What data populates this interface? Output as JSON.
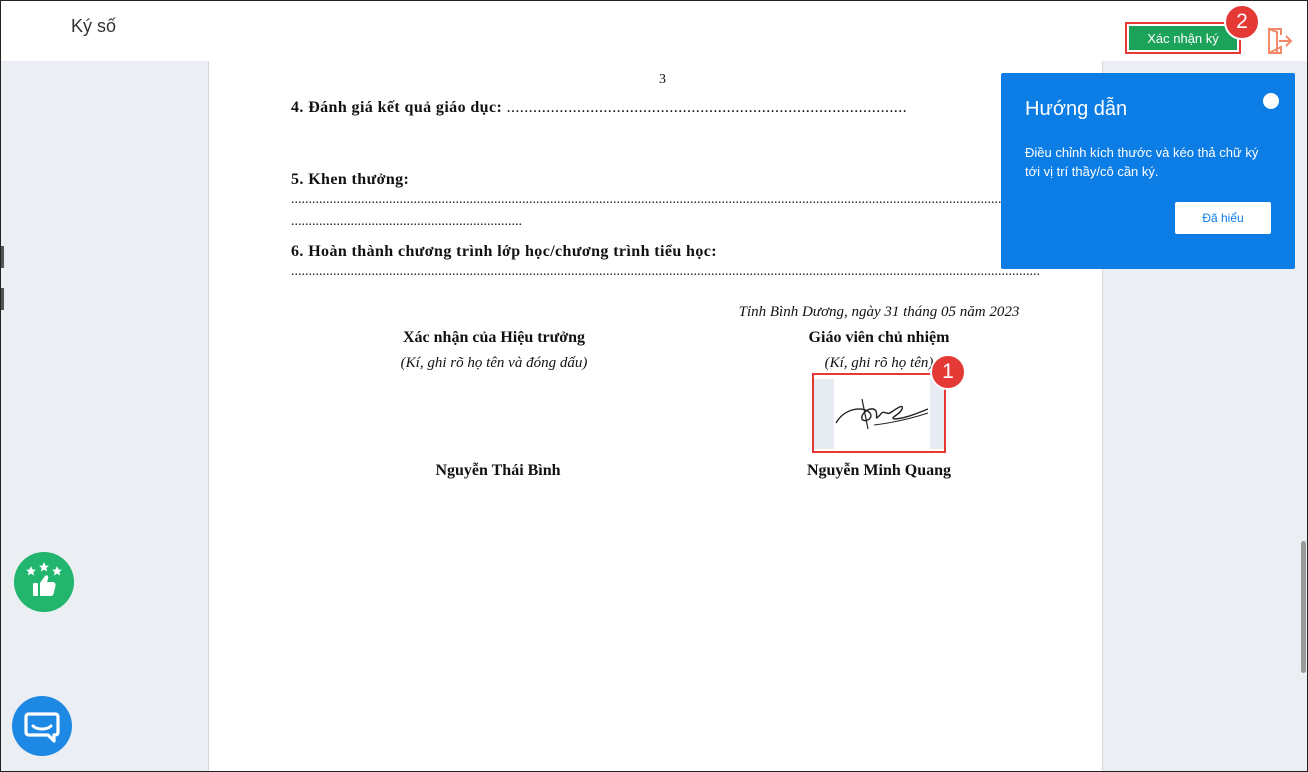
{
  "header": {
    "title": "Ký số",
    "confirm_label": "Xác nhận ký",
    "step_badge": "2",
    "exit_icon": "exit-door-icon"
  },
  "document": {
    "page_number": "3",
    "section4": {
      "heading": "4. Đánh giá kết quả giáo dục:",
      "dots": " ..........................................................................................."
    },
    "section5": {
      "heading": "5. Khen thưởng:",
      "line1": "......................................................................................................................................................................................................................",
      "line2": ".................................................................."
    },
    "section6": {
      "heading": "6. Hoàn thành chương trình lớp học/chương trình tiểu học:",
      "line1": "......................................................................................................................................................................................................................"
    },
    "place_date": "Tỉnh Bình Dương, ngày 31 tháng 05 năm 2023",
    "left_sign": {
      "title": "Xác nhận của Hiệu trưởng",
      "note": "(Kí, ghi rõ họ tên và đóng dấu)",
      "name": "Nguyễn Thái Bình"
    },
    "right_sign": {
      "title": "Giáo viên chủ nhiệm",
      "note": "(Kí, ghi rõ họ tên)",
      "name": "Nguyễn Minh Quang"
    },
    "step_badge": "1"
  },
  "guide": {
    "title": "Hướng dẫn",
    "text": "Điều chỉnh kích thước và kéo thả chữ ký tới vị trí thầy/cô cần ký.",
    "button": "Đã hiểu"
  },
  "colors": {
    "confirm_green": "#1ca35a",
    "guide_blue": "#0d7de6",
    "highlight_red": "#e53935",
    "rate_green": "#21b56d",
    "chat_blue": "#1e88e5"
  },
  "widgets": {
    "rate_icon": "thumbs-up-stars-icon",
    "chat_icon": "chat-bubble-icon"
  }
}
